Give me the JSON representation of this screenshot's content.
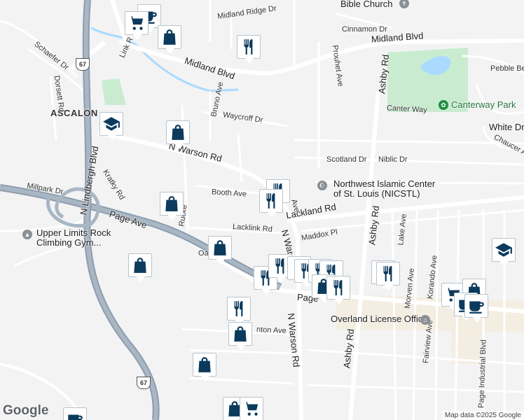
{
  "map": {
    "area_label": "ASCALON",
    "attribution": "Map data ©2025 Google",
    "logo": "Google",
    "highway_shields": [
      "67",
      "67"
    ],
    "roads": [
      "Midland Ridge Dr",
      "Midland Blvd",
      "Midland Blvd",
      "Cinnamon Dr",
      "Pebble Bea",
      "Schaefer Dr",
      "Link R",
      "Dorsett Rd",
      "Bruno Ave",
      "Waycroff Dr",
      "Canter Way",
      "White Dr",
      "Chaucer Ave",
      "N Warson Rd",
      "Scotland Dr",
      "Niblic Dr",
      "Prouhet Ave",
      "Ashby Rd",
      "Kratky Rd",
      "N Lindbergh Blvd",
      "Millpark Dr",
      "Booth Ave",
      "Lackland Rd",
      "Page Ave",
      "Lacklink Rd",
      "Maddox Pl",
      "Rucke",
      "N War",
      "Oa",
      "Lake Ave",
      "Morven Ave",
      "Korando Ave",
      "Fairview Ave",
      "Page",
      "nton Ave",
      "N Warson Rd",
      "Ashby Rd",
      "Page Industrial Blvd",
      "Ashby Rd",
      "Ave"
    ],
    "places": [
      {
        "name": "Bible Church",
        "icon": "church"
      },
      {
        "name": "Canterway Park",
        "icon": "park-icon"
      },
      {
        "name": "Northwest Islamic Center\nof St. Louis (NICSTL)",
        "icon": "mosque-icon"
      },
      {
        "name": "Upper Limits Rock\nClimbing Gym...",
        "icon": "gym-icon"
      },
      {
        "name": "Overland License Office",
        "icon": "government-icon"
      }
    ],
    "markers": [
      "cafe",
      "cart",
      "shopping",
      "restaurant",
      "school",
      "shopping",
      "restaurant",
      "restaurant",
      "shopping",
      "shopping",
      "shopping",
      "restaurant",
      "restaurant",
      "restaurant",
      "restaurant",
      "restaurant",
      "restaurant",
      "shopping",
      "restaurant",
      "restaurant",
      "restaurant",
      "school",
      "cart",
      "shopping",
      "cafe",
      "cafe",
      "restaurant",
      "shopping",
      "shopping",
      "shopping",
      "cart",
      "cafe"
    ],
    "colors": {
      "background": "#f3f3f4",
      "road": "#ffffff",
      "highway": "#8e9dae",
      "water": "#aadaff",
      "park": "#c9ecd0",
      "marker_icon": "#0b3a5c"
    }
  }
}
